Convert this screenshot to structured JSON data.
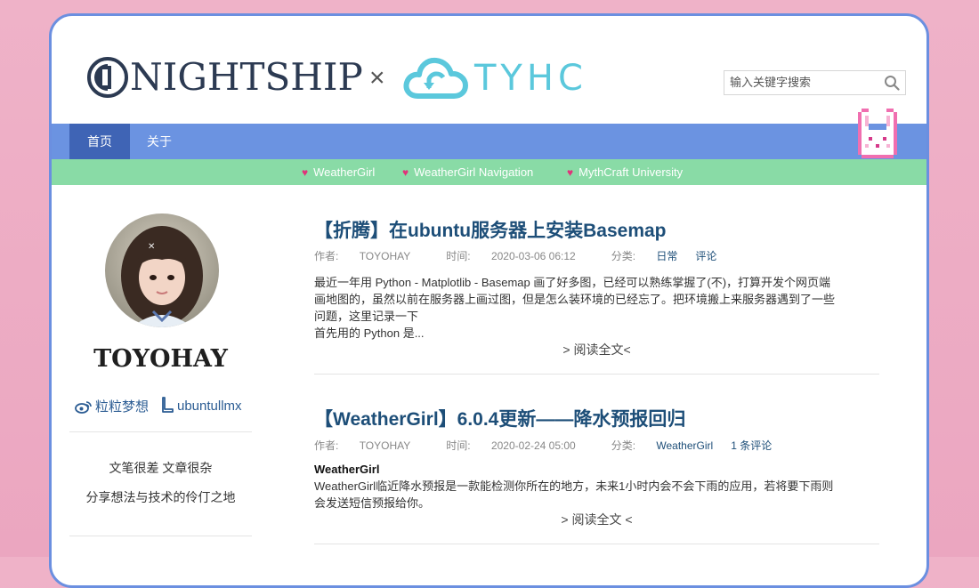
{
  "header": {
    "logo_left": "NIGHTSHIP",
    "logo_times": "×",
    "logo_right": "TYHC",
    "search_placeholder": "输入关键字搜索"
  },
  "nav": [
    {
      "label": "首页",
      "active": true
    },
    {
      "label": "关于",
      "active": false
    }
  ],
  "links": [
    {
      "label": "WeatherGirl"
    },
    {
      "label": "WeatherGirl Navigation"
    },
    {
      "label": "MythCraft University"
    }
  ],
  "sidebar": {
    "username": "TOYOHAY",
    "weibo": "粒粒梦想",
    "github": "ubuntullmx",
    "tagline1": "文笔很差 文章很杂",
    "tagline2": "分享想法与技术的伶仃之地"
  },
  "posts": [
    {
      "title": "【折腾】在ubuntu服务器上安装Basemap",
      "author_label": "作者:",
      "author": "TOYOHAY",
      "time_label": "时间:",
      "time": "2020-03-06 06:12",
      "category_label": "分类:",
      "category": "日常",
      "comments": "评论",
      "excerpt_line1": "最近一年用 Python - Matplotlib - Basemap 画了好多图，已经可以熟练掌握了(不)，打算开发个网页端",
      "excerpt_line2": "画地图的，虽然以前在服务器上画过图，但是怎么装环境的已经忘了。把环境搬上来服务器遇到了一些",
      "excerpt_line3": "问题，这里记录一下",
      "excerpt_line4": "首先用的 Python 是...",
      "readmore": "> 阅读全文<"
    },
    {
      "title": "【WeatherGirl】6.0.4更新——降水预报回归",
      "author_label": "作者:",
      "author": "TOYOHAY",
      "time_label": "时间:",
      "time": "2020-02-24 05:00",
      "category_label": "分类:",
      "category": "WeatherGirl",
      "comments": "1 条评论",
      "excerpt_heading": "WeatherGirl",
      "excerpt_line1": "WeatherGirl临近降水预报是一款能检测你所在的地方，未来1小时内会不会下雨的应用，若将要下雨则",
      "excerpt_line2": "会发送短信预报给你。",
      "readmore": "> 阅读全文 <"
    }
  ],
  "colors": {
    "nav": "#6b93e1",
    "nav_active": "#3f64b5",
    "links_bar": "#89dba6",
    "title": "#1d4e78",
    "frame_border": "#6b8fe0",
    "background": "#efb2c8"
  }
}
